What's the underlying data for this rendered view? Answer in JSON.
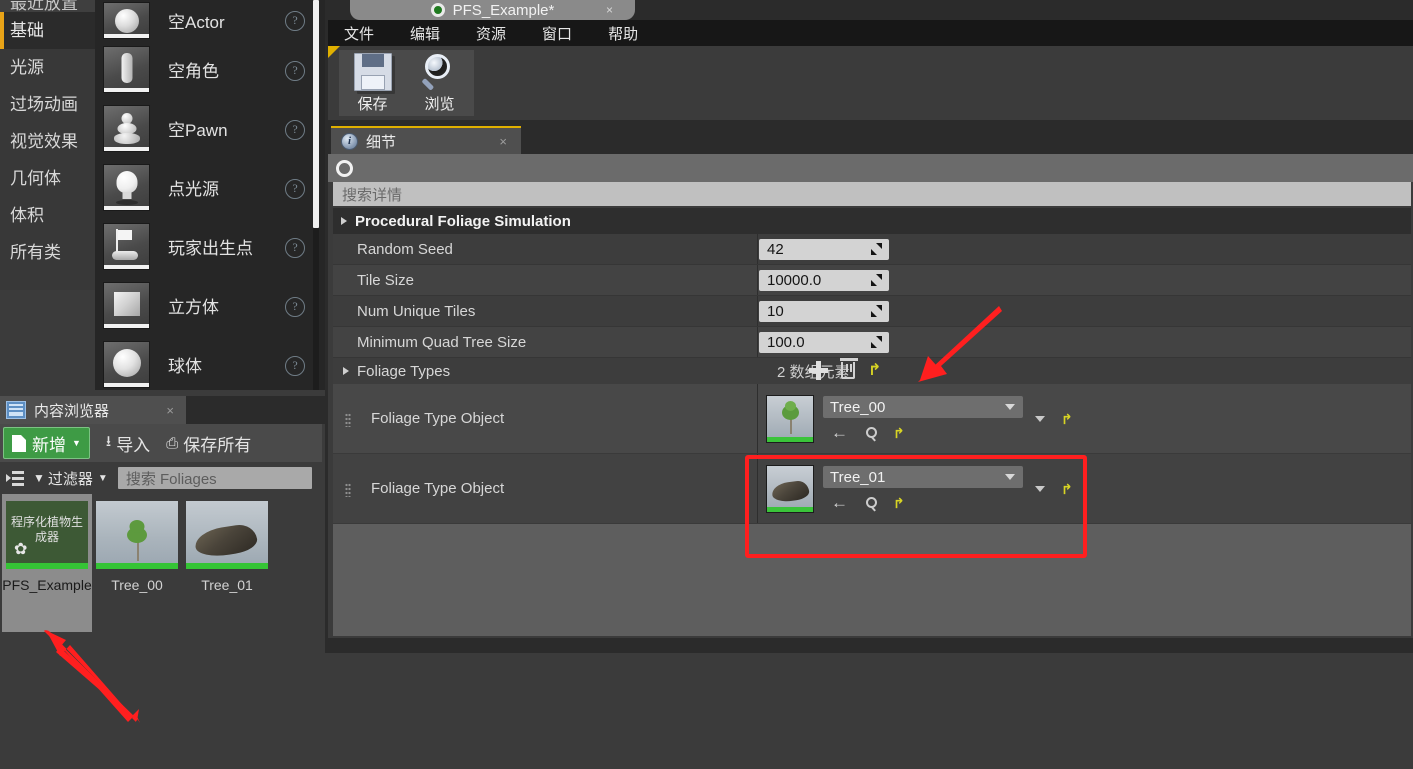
{
  "place_actors": {
    "categories": [
      {
        "label": "最近放置",
        "partial": true,
        "active": false
      },
      {
        "label": "基础",
        "partial": false,
        "active": true
      },
      {
        "label": "光源",
        "partial": false,
        "active": false
      },
      {
        "label": "过场动画",
        "partial": false,
        "active": false
      },
      {
        "label": "视觉效果",
        "partial": false,
        "active": false
      },
      {
        "label": "几何体",
        "partial": false,
        "active": false
      },
      {
        "label": "体积",
        "partial": false,
        "active": false
      },
      {
        "label": "所有类",
        "partial": false,
        "active": false
      }
    ],
    "items": [
      {
        "label": "空Actor",
        "icon": "sphere-thumbnail"
      },
      {
        "label": "空角色",
        "icon": "character-thumbnail"
      },
      {
        "label": "空Pawn",
        "icon": "pawn-thumbnail"
      },
      {
        "label": "点光源",
        "icon": "pointlight-thumbnail"
      },
      {
        "label": "玩家出生点",
        "icon": "playerstart-thumbnail"
      },
      {
        "label": "立方体",
        "icon": "cube-thumbnail"
      },
      {
        "label": "球体",
        "icon": "sphere-thumbnail"
      }
    ],
    "help_glyph": "?"
  },
  "content_browser": {
    "tab_label": "内容浏览器",
    "tab_close": "×",
    "toolbar": {
      "add_label": "新增",
      "add_carat": "▼",
      "import_label": "导入",
      "import_glyph": "⭳",
      "save_all_label": "保存所有",
      "save_all_glyph": "⎙"
    },
    "filter_label": "过滤器",
    "filter_funnel": "▼",
    "filter_carat": "▼",
    "search_placeholder": "搜索 Foliages",
    "assets": [
      {
        "name": "PFS_Example",
        "caption": "程序化植物生\n成器",
        "selected": true
      },
      {
        "name": "Tree_00",
        "selected": false
      },
      {
        "name": "Tree_01",
        "selected": false
      }
    ],
    "pfs_caption_line1": "程序化植物生",
    "pfs_caption_line2": "成器",
    "pfs_star": "✿"
  },
  "editor": {
    "tab_title": "PFS_Example*",
    "tab_close": "×",
    "menu": [
      "文件",
      "编辑",
      "资源",
      "窗口",
      "帮助"
    ],
    "toolbar_buttons": [
      {
        "label": "保存",
        "icon": "save-icon"
      },
      {
        "label": "浏览",
        "icon": "browse-icon"
      }
    ]
  },
  "details": {
    "tab_label": "细节",
    "tab_close": "×",
    "tab_icon_glyph": "i",
    "search_placeholder": "搜索详情",
    "category_title": "Procedural Foliage Simulation",
    "properties": [
      {
        "name": "Random Seed",
        "value": "42"
      },
      {
        "name": "Tile Size",
        "value": "10000.0"
      },
      {
        "name": "Num Unique Tiles",
        "value": "10"
      },
      {
        "name": "Minimum Quad Tree Size",
        "value": "100.0"
      }
    ],
    "foliage_types": {
      "label": "Foliage Types",
      "count_text": "2 数组元素",
      "actions": [
        {
          "name": "add-element",
          "glyph": "+"
        },
        {
          "name": "delete-all",
          "glyph": "🗑"
        },
        {
          "name": "reset-to-default",
          "glyph": "↰"
        }
      ],
      "rows": [
        {
          "name": "Foliage Type Object",
          "asset": "Tree_00",
          "thumb": "tree-thumbnail",
          "highlighted": false
        },
        {
          "name": "Foliage Type Object",
          "asset": "Tree_01",
          "thumb": "rock-thumbnail",
          "highlighted": true
        }
      ],
      "row_icons": {
        "use_selected": "←",
        "browse": "search-icon",
        "reset": "↰",
        "dropdown": "▼"
      }
    }
  },
  "annotations": {
    "accent_color": "#ff1f1f",
    "arrow_add_target": "add-element-button",
    "arrow_asset_target": "PFS_Example"
  },
  "colors": {
    "accent_yellow": "#e0b000",
    "highlight_red": "#ff1f1f",
    "green_button": "#3e9b45",
    "reset_yellow": "#d8d424"
  }
}
